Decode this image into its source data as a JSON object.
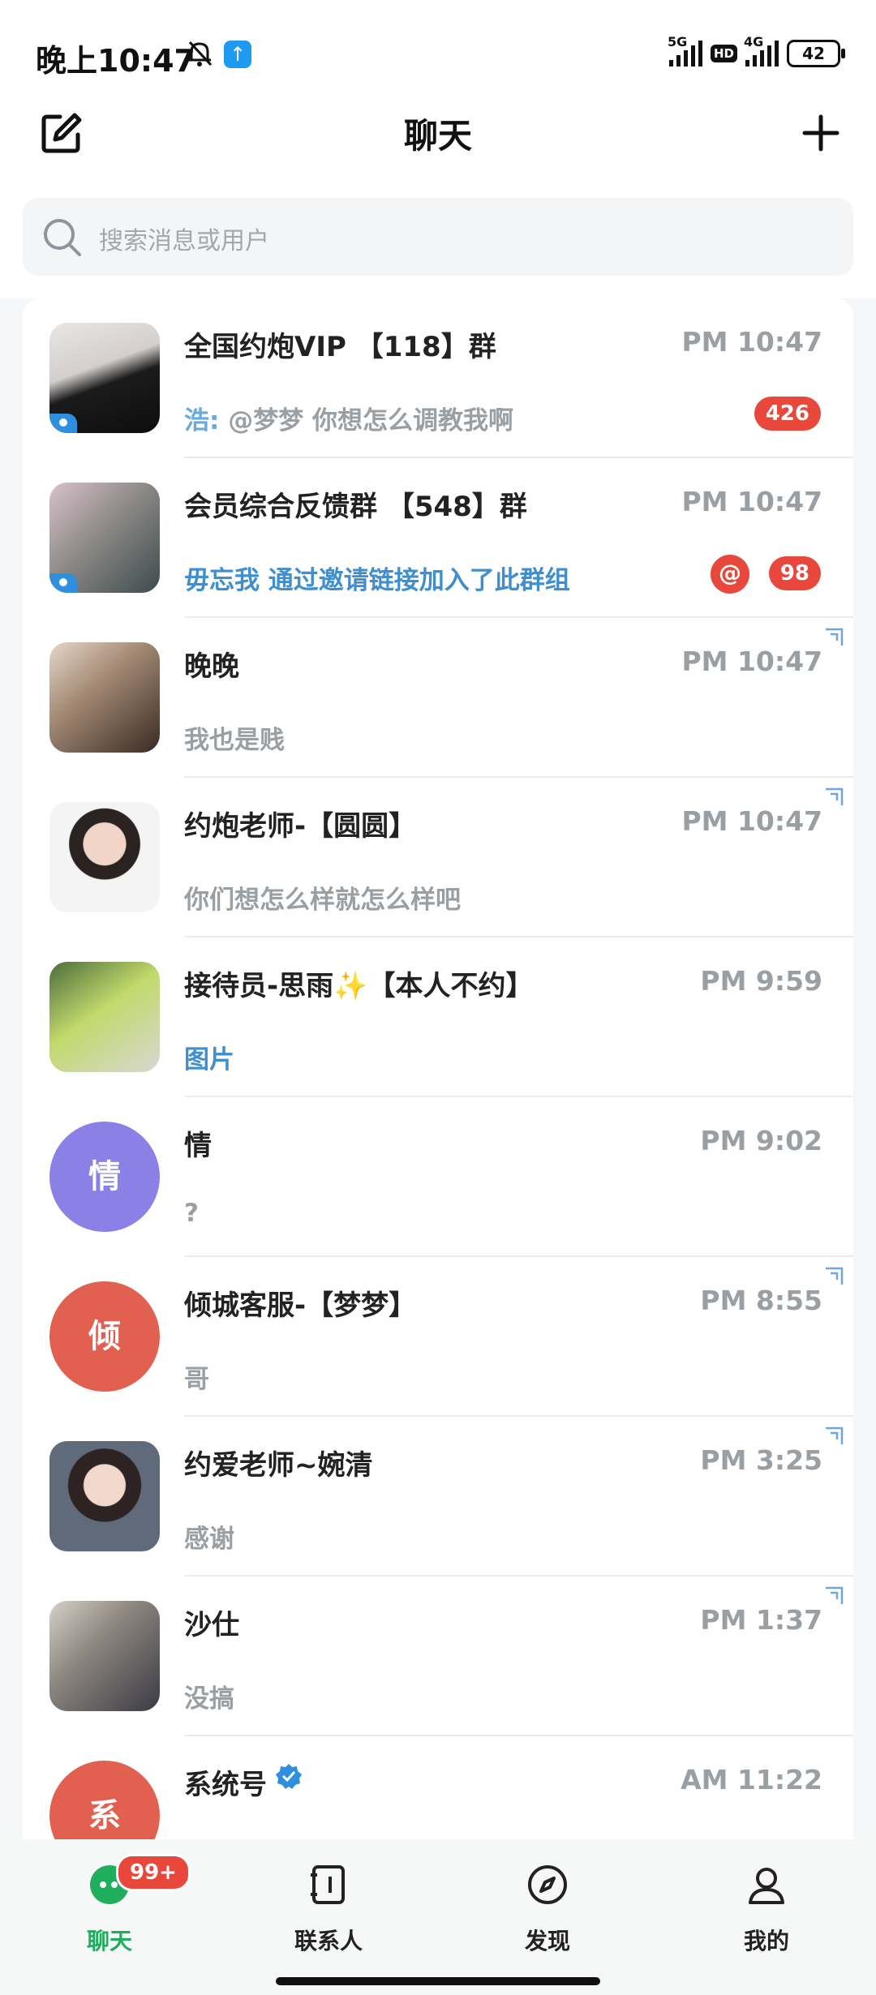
{
  "status_bar": {
    "time": "晚上10:47",
    "net1": "5G",
    "hd": "HD",
    "net2": "4G",
    "battery": "42"
  },
  "header": {
    "title": "聊天",
    "edit_icon": "compose-icon",
    "add_icon": "plus-icon"
  },
  "search": {
    "placeholder": "搜索消息或用户"
  },
  "chats": [
    {
      "name": "全国约炮VIP 【118】群",
      "time": "PM 10:47",
      "sender": "浩:",
      "message": " @梦梦 你想怎么调教我啊",
      "badge": "426",
      "group": true
    },
    {
      "name": "会员综合反馈群 【548】群",
      "time": "PM 10:47",
      "message": "毋忘我 通过邀请链接加入了此群组",
      "at_badge": "@",
      "badge": "98",
      "group": true
    },
    {
      "name": "晚晚",
      "time": "PM 10:47",
      "message": "我也是贱"
    },
    {
      "name": "约炮老师-【圆圆】",
      "time": "PM 10:47",
      "message": "你们想怎么样就怎么样吧"
    },
    {
      "name": "接待员-思雨✨【本人不约】",
      "time": "PM 9:59",
      "message": "图片"
    },
    {
      "name": "情",
      "time": "PM 9:02",
      "message": "?",
      "avatar_letter": "情",
      "avatar_color": "#8b80e6"
    },
    {
      "name": "倾城客服-【梦梦】",
      "time": "PM 8:55",
      "message": "哥",
      "avatar_letter": "倾",
      "avatar_color": "#e1604f"
    },
    {
      "name": "约爱老师~婉清",
      "time": "PM 3:25",
      "message": "感谢"
    },
    {
      "name": "沙仕",
      "time": "PM 1:37",
      "message": "没搞"
    },
    {
      "name": "系统号",
      "time": "AM 11:22",
      "avatar_letter": "系",
      "avatar_color": "#e1604f",
      "verified": true
    }
  ],
  "nav": {
    "items": [
      "聊天",
      "联系人",
      "发现",
      "我的"
    ],
    "badge": "99+",
    "active_color": "#1fae5b"
  }
}
